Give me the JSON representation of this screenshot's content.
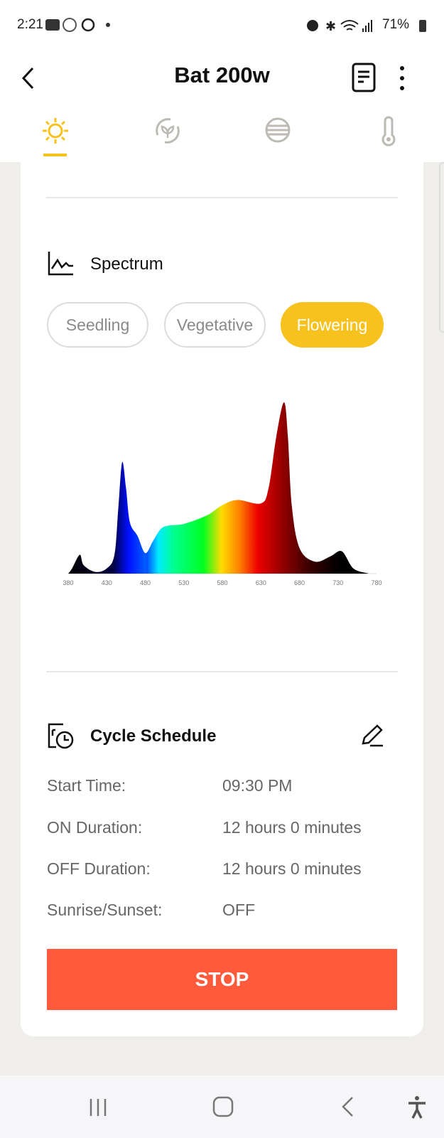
{
  "status_bar": {
    "time": "2:21",
    "battery": "71%",
    "icons": [
      "voicemail-icon",
      "app-icon",
      "circle-icon",
      "dot-icon",
      "alarm-icon",
      "bluetooth-icon",
      "wifi-icon",
      "signal-icon",
      "battery-icon"
    ]
  },
  "header": {
    "title": "Bat 200w",
    "icons": [
      "back-icon",
      "document-icon",
      "more-vert-icon"
    ]
  },
  "tabs": [
    {
      "icon": "sun-icon",
      "active": true
    },
    {
      "icon": "plant-cycle-icon",
      "active": false
    },
    {
      "icon": "lines-circle-icon",
      "active": false
    },
    {
      "icon": "thermometer-icon",
      "active": false
    }
  ],
  "colors": {
    "accent": "#f7c21d",
    "stop": "#fe5a3b",
    "inactive_icon": "#bdbab4"
  },
  "spectrum": {
    "title": "Spectrum",
    "presets": [
      {
        "label": "Seedling",
        "active": false
      },
      {
        "label": "Vegetative",
        "active": false
      },
      {
        "label": "Flowering",
        "active": true
      }
    ]
  },
  "chart_data": {
    "type": "area",
    "title": "",
    "xlabel": "",
    "ylabel": "",
    "xlim": [
      380,
      780
    ],
    "ylim": [
      0,
      1
    ],
    "grid": false,
    "x_ticks": [
      380,
      430,
      480,
      530,
      580,
      630,
      680,
      730,
      780
    ],
    "x": [
      380,
      385,
      395,
      400,
      415,
      430,
      440,
      445,
      450,
      455,
      460,
      470,
      480,
      490,
      500,
      510,
      530,
      560,
      580,
      600,
      630,
      640,
      650,
      660,
      665,
      670,
      680,
      700,
      720,
      735,
      750,
      770
    ],
    "values": [
      0,
      0.03,
      0.11,
      0.05,
      0.01,
      0.03,
      0.11,
      0.38,
      0.65,
      0.5,
      0.3,
      0.22,
      0.12,
      0.19,
      0.26,
      0.28,
      0.29,
      0.34,
      0.4,
      0.43,
      0.41,
      0.5,
      0.8,
      1.0,
      0.8,
      0.4,
      0.15,
      0.07,
      0.1,
      0.13,
      0.03,
      0
    ]
  },
  "schedule": {
    "title": "Cycle Schedule",
    "rows": [
      {
        "label": "Start Time:",
        "value": "09:30 PM"
      },
      {
        "label": "ON Duration:",
        "value": "12 hours 0 minutes"
      },
      {
        "label": "OFF Duration:",
        "value": "12 hours 0 minutes"
      },
      {
        "label": "Sunrise/Sunset:",
        "value": "OFF"
      }
    ],
    "stop_label": "STOP"
  },
  "nav_bar": {
    "icons": [
      "recents-icon",
      "home-icon",
      "back-icon",
      "accessibility-icon"
    ]
  }
}
